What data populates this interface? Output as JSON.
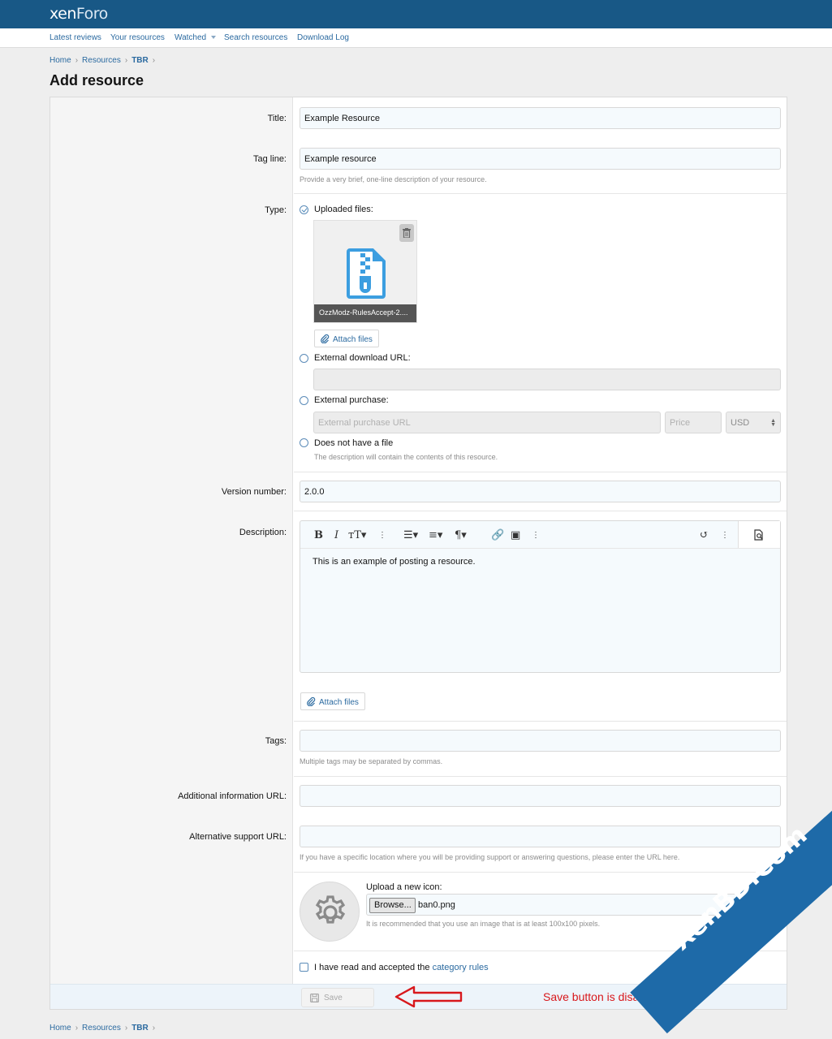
{
  "header": {
    "logo_part1": "xen",
    "logo_part2": "Foro"
  },
  "subnav": [
    {
      "label": "Latest reviews"
    },
    {
      "label": "Your resources"
    },
    {
      "label": "Watched"
    },
    {
      "label": "Search resources"
    },
    {
      "label": "Download Log"
    }
  ],
  "breadcrumb": [
    "Home",
    "Resources",
    "TBR"
  ],
  "page_title": "Add resource",
  "form": {
    "title_label": "Title:",
    "title_value": "Example Resource",
    "tagline_label": "Tag line:",
    "tagline_value": "Example resource",
    "tagline_hint": "Provide a very brief, one-line description of your resource.",
    "type_label": "Type:",
    "type_uploaded": "Uploaded files:",
    "uploaded_file_name": "OzzModz-RulesAccept-2....",
    "attach_files": "Attach files",
    "type_external_url": "External download URL:",
    "type_external_purchase": "External purchase:",
    "purchase_url_placeholder": "External purchase URL",
    "price_placeholder": "Price",
    "currency": "USD",
    "type_no_file": "Does not have a file",
    "type_no_file_hint": "The description will contain the contents of this resource.",
    "version_label": "Version number:",
    "version_value": "2.0.0",
    "description_label": "Description:",
    "description_text": "This is an example of posting a resource.",
    "tags_label": "Tags:",
    "tags_hint": "Multiple tags may be separated by commas.",
    "info_url_label": "Additional information URL:",
    "support_url_label": "Alternative support URL:",
    "support_url_hint": "If you have a specific location where you will be providing support or answering questions, please enter the URL here.",
    "icon_upload_label": "Upload a new icon:",
    "browse_label": "Browse...",
    "icon_file": "ban0.png",
    "icon_hint": "It is recommended that you use an image that is at least 100x100 pixels.",
    "rules_text": "I have read and accepted the",
    "rules_link": "category rules",
    "save_label": "Save"
  },
  "annotation": "Save button is disabled",
  "watermark": "XenBD.Com",
  "colors": {
    "header": "#185886",
    "link": "#2b6aa0",
    "annotation": "#d8181c"
  }
}
